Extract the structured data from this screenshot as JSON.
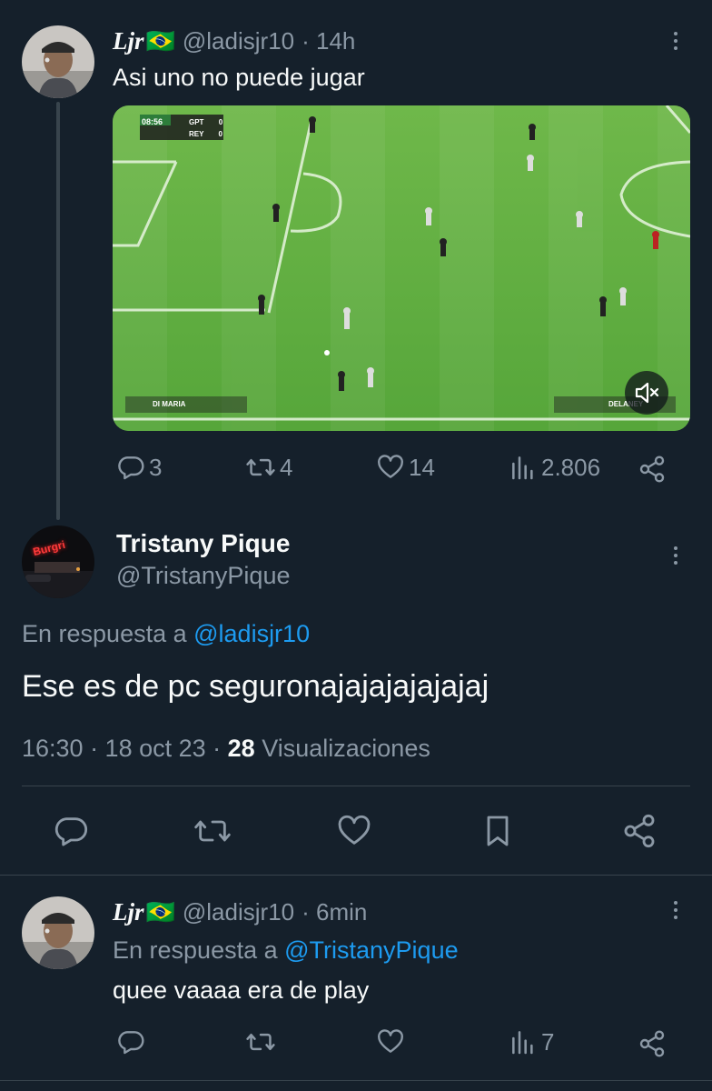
{
  "colors": {
    "background": "#15202b",
    "text": "#f7f9f9",
    "muted": "#8b98a5",
    "link": "#1d9bf0",
    "divider": "#38444d"
  },
  "tweet1": {
    "display_name": "Ljr",
    "flag": "🇧🇷",
    "handle": "@ladisjr10",
    "time": "· 14h",
    "text": "Asi uno no puede jugar",
    "video": {
      "score_time": "08:56",
      "team1": "GPT",
      "team2": "REY",
      "score1": "0",
      "score2": "0",
      "player_left": "DI MARIA",
      "player_right": "DELANEY",
      "mute_icon": "speaker-muted-icon"
    },
    "actions": {
      "replies": "3",
      "retweets": "4",
      "likes": "14",
      "views": "2.806"
    }
  },
  "tweet2": {
    "display_name": "Tristany Pique",
    "handle": "@TristanyPique",
    "reply_prefix": "En respuesta a ",
    "reply_to": "@ladisjr10",
    "text": "Ese es de pc seguronajajajajajajaj",
    "time": "16:30 · 18 oct 23 ·",
    "views_count": "28",
    "views_label": "Visualizaciones",
    "avatar_text": "Burgri"
  },
  "tweet3": {
    "display_name": "Ljr",
    "flag": "🇧🇷",
    "handle": "@ladisjr10",
    "time": "· 6min",
    "reply_prefix": "En respuesta a ",
    "reply_to": "@TristanyPique",
    "text": "quee vaaaa era de play",
    "actions": {
      "views": "7"
    }
  }
}
